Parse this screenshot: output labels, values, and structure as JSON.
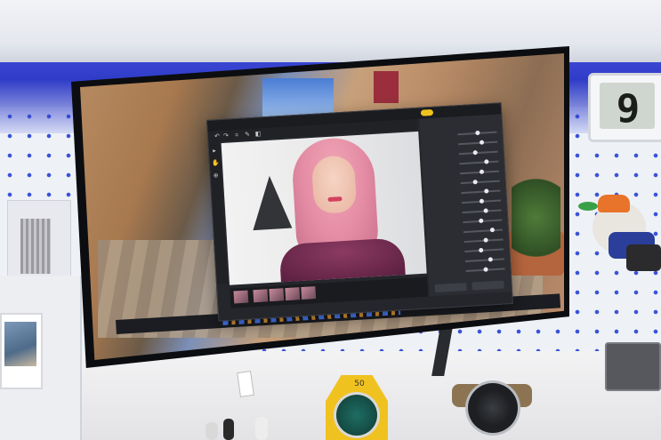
{
  "scene": {
    "clock_display": "9",
    "speaker_label": "50",
    "app_window": {
      "title": "",
      "panel_title": "",
      "reset_label": "",
      "apply_label": "",
      "badge_label": "",
      "taskbar_time": ""
    }
  },
  "colors": {
    "backlight": "#3a47d8",
    "pegboard_dots": "#3a52d8",
    "hair_pink": "#e48ba4",
    "speaker_yellow": "#f0c21f",
    "shutter_red": "#9a2e3c"
  }
}
